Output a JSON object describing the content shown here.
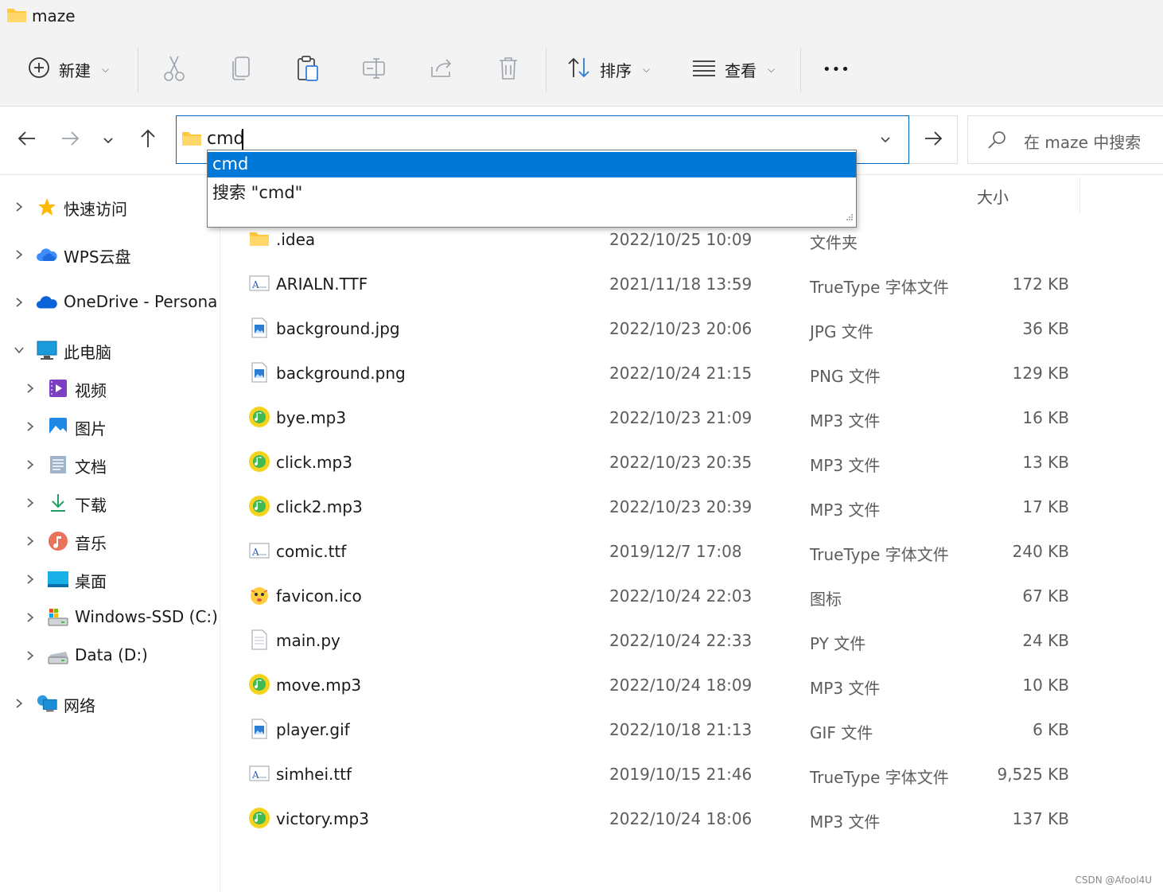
{
  "window": {
    "title": "maze"
  },
  "toolbar": {
    "new_label": "新建",
    "sort_label": "排序",
    "view_label": "查看",
    "more_label": "•••"
  },
  "address": {
    "value": "cmd",
    "suggestions": [
      "cmd",
      "搜索 \"cmd\""
    ]
  },
  "search": {
    "placeholder": "在 maze 中搜索"
  },
  "sidebar": {
    "items": [
      {
        "label": "快速访问"
      },
      {
        "label": "WPS云盘"
      },
      {
        "label": "OneDrive - Persona"
      },
      {
        "label": "此电脑"
      },
      {
        "label": "视频"
      },
      {
        "label": "图片"
      },
      {
        "label": "文档"
      },
      {
        "label": "下载"
      },
      {
        "label": "音乐"
      },
      {
        "label": "桌面"
      },
      {
        "label": "Windows-SSD (C:)"
      },
      {
        "label": "Data (D:)"
      },
      {
        "label": "网络"
      }
    ]
  },
  "columns": {
    "size": "大小"
  },
  "files": [
    {
      "name": ".idea",
      "date": "2022/10/25 10:09",
      "type": "文件夹",
      "size": "",
      "icon": "folder-icon"
    },
    {
      "name": "ARIALN.TTF",
      "date": "2021/11/18 13:59",
      "type": "TrueType 字体文件",
      "size": "172 KB",
      "icon": "font-file-icon"
    },
    {
      "name": "background.jpg",
      "date": "2022/10/23 20:06",
      "type": "JPG 文件",
      "size": "36 KB",
      "icon": "image-file-icon"
    },
    {
      "name": "background.png",
      "date": "2022/10/24 21:15",
      "type": "PNG 文件",
      "size": "129 KB",
      "icon": "image-file-icon"
    },
    {
      "name": "bye.mp3",
      "date": "2022/10/23 21:09",
      "type": "MP3 文件",
      "size": "16 KB",
      "icon": "audio-file-icon"
    },
    {
      "name": "click.mp3",
      "date": "2022/10/23 20:35",
      "type": "MP3 文件",
      "size": "13 KB",
      "icon": "audio-file-icon"
    },
    {
      "name": "click2.mp3",
      "date": "2022/10/23 20:39",
      "type": "MP3 文件",
      "size": "17 KB",
      "icon": "audio-file-icon"
    },
    {
      "name": "comic.ttf",
      "date": "2019/12/7 17:08",
      "type": "TrueType 字体文件",
      "size": "240 KB",
      "icon": "font-file-icon"
    },
    {
      "name": "favicon.ico",
      "date": "2022/10/24 22:03",
      "type": "图标",
      "size": "67 KB",
      "icon": "favicon-icon"
    },
    {
      "name": "main.py",
      "date": "2022/10/24 22:33",
      "type": "PY 文件",
      "size": "24 KB",
      "icon": "text-file-icon"
    },
    {
      "name": "move.mp3",
      "date": "2022/10/24 18:09",
      "type": "MP3 文件",
      "size": "10 KB",
      "icon": "audio-file-icon"
    },
    {
      "name": "player.gif",
      "date": "2022/10/18 21:13",
      "type": "GIF 文件",
      "size": "6 KB",
      "icon": "image-file-icon"
    },
    {
      "name": "simhei.ttf",
      "date": "2019/10/15 21:46",
      "type": "TrueType 字体文件",
      "size": "9,525 KB",
      "icon": "font-file-icon"
    },
    {
      "name": "victory.mp3",
      "date": "2022/10/24 18:06",
      "type": "MP3 文件",
      "size": "137 KB",
      "icon": "audio-file-icon"
    }
  ],
  "watermark": "CSDN @Afool4U",
  "colors": {
    "accent": "#0078d7",
    "toolbar_bg": "#f3f3f3",
    "folder": "#ffc83d"
  }
}
